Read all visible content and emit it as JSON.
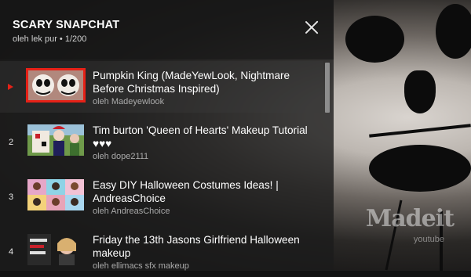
{
  "playlist": {
    "title": "SCARY SNAPCHAT",
    "subtitle": "oleh lek pur • 1/200"
  },
  "video_watermark": {
    "brand": "Madeit",
    "sub": "youtube"
  },
  "items": [
    {
      "index": "",
      "title": "Pumpkin King (MadeYewLook, Nightmare Before Christmas Inspired)",
      "channel": "oleh Madeyewlook",
      "playing": true
    },
    {
      "index": "2",
      "title": "Tim burton 'Queen of Hearts' Makeup Tutorial ♥♥♥",
      "channel": "oleh dope2111",
      "playing": false
    },
    {
      "index": "3",
      "title": "Easy DIY Halloween Costumes Ideas! | AndreasChoice",
      "channel": "oleh AndreasChoice",
      "playing": false
    },
    {
      "index": "4",
      "title": "Friday the 13th Jasons Girlfriend Halloween makeup",
      "channel": "oleh ellimacs sfx makeup",
      "playing": false
    }
  ],
  "colors": {
    "accent": "#e62117",
    "text": "#ffffff",
    "muted": "#aaaaaa"
  }
}
